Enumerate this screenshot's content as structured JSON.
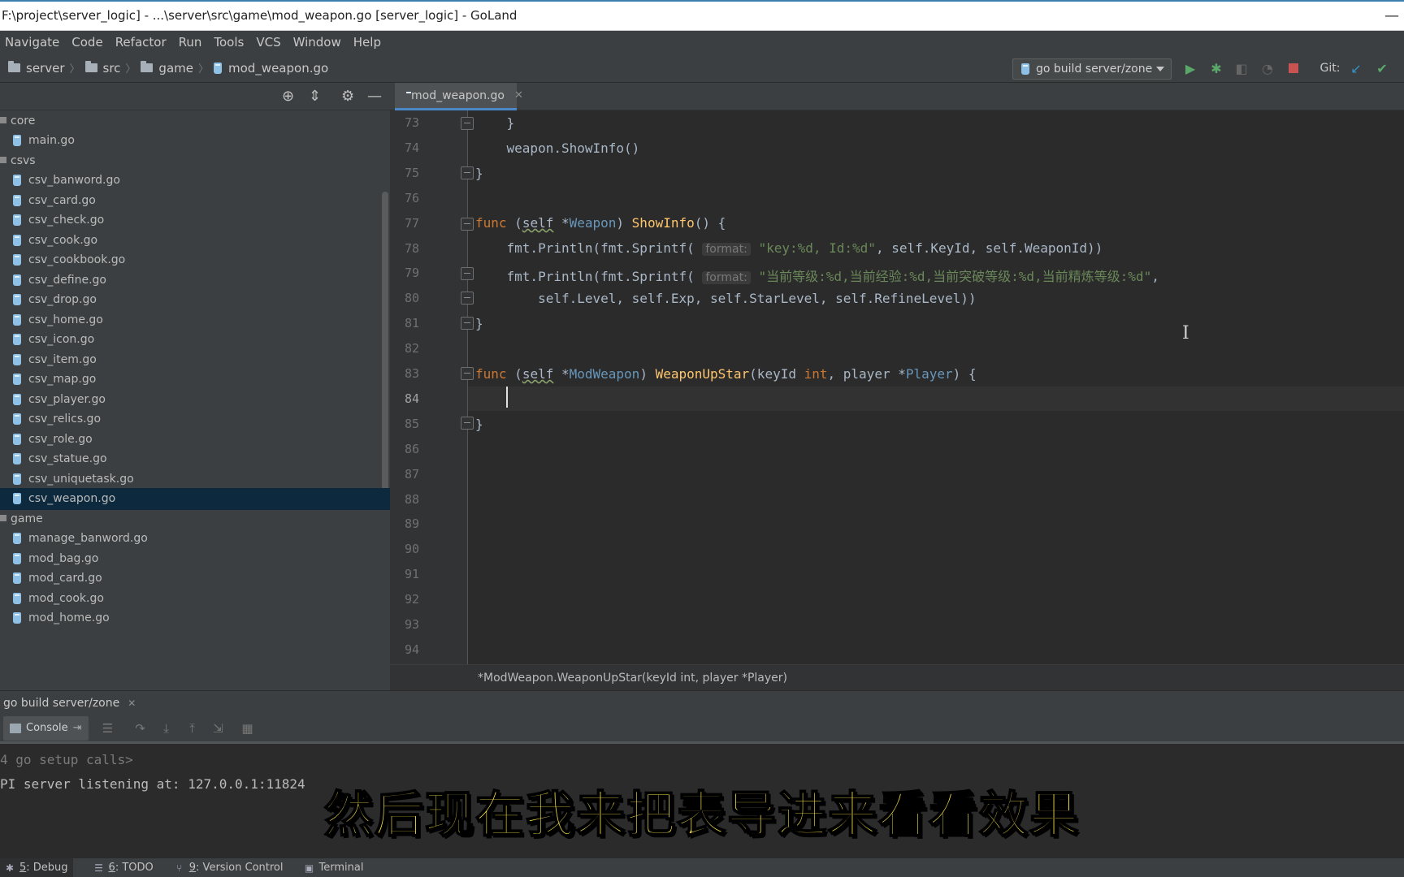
{
  "window": {
    "title": "F:\\project\\server_logic] - ...\\server\\src\\game\\mod_weapon.go [server_logic] - GoLand",
    "minimize_glyph": "—"
  },
  "menu": [
    "Navigate",
    "Code",
    "Refactor",
    "Run",
    "Tools",
    "VCS",
    "Window",
    "Help"
  ],
  "breadcrumbs": [
    "server",
    "src",
    "game",
    "mod_weapon.go"
  ],
  "run_config": {
    "label": "go build server/zone"
  },
  "vcs_label": "Git:",
  "project_tree": {
    "items": [
      {
        "kind": "dir",
        "label": "core"
      },
      {
        "kind": "file",
        "label": "main.go"
      },
      {
        "kind": "dir",
        "label": "csvs"
      },
      {
        "kind": "file",
        "label": "csv_banword.go"
      },
      {
        "kind": "file",
        "label": "csv_card.go"
      },
      {
        "kind": "file",
        "label": "csv_check.go"
      },
      {
        "kind": "file",
        "label": "csv_cook.go"
      },
      {
        "kind": "file",
        "label": "csv_cookbook.go"
      },
      {
        "kind": "file",
        "label": "csv_define.go"
      },
      {
        "kind": "file",
        "label": "csv_drop.go"
      },
      {
        "kind": "file",
        "label": "csv_home.go"
      },
      {
        "kind": "file",
        "label": "csv_icon.go"
      },
      {
        "kind": "file",
        "label": "csv_item.go"
      },
      {
        "kind": "file",
        "label": "csv_map.go"
      },
      {
        "kind": "file",
        "label": "csv_player.go"
      },
      {
        "kind": "file",
        "label": "csv_relics.go"
      },
      {
        "kind": "file",
        "label": "csv_role.go"
      },
      {
        "kind": "file",
        "label": "csv_statue.go"
      },
      {
        "kind": "file",
        "label": "csv_uniquetask.go"
      },
      {
        "kind": "file",
        "label": "csv_weapon.go",
        "selected": true
      },
      {
        "kind": "dir",
        "label": "game"
      },
      {
        "kind": "file",
        "label": "manage_banword.go"
      },
      {
        "kind": "file",
        "label": "mod_bag.go"
      },
      {
        "kind": "file",
        "label": "mod_card.go"
      },
      {
        "kind": "file",
        "label": "mod_cook.go"
      },
      {
        "kind": "file",
        "label": "mod_home.go"
      }
    ]
  },
  "editor": {
    "tab_label": "mod_weapon.go",
    "line_numbers": [
      "73",
      "74",
      "75",
      "76",
      "77",
      "78",
      "79",
      "80",
      "81",
      "82",
      "83",
      "84",
      "85",
      "86",
      "87",
      "88",
      "89",
      "90",
      "91",
      "92",
      "93",
      "94"
    ],
    "current_line": "84",
    "code": {
      "l73": "    }",
      "l74": "    weapon.ShowInfo()",
      "l75": "}",
      "l77": {
        "func": "func",
        "open": "(",
        "recv": "self",
        "star": " *",
        "type": "Weapon",
        "close": ") ",
        "name": "ShowInfo",
        "rest": "() {"
      },
      "l78": {
        "pre": "    fmt.Println(fmt.Sprintf(",
        "hint": "format:",
        "str": "\"key:%d, Id:%d\"",
        "rest": ", self.KeyId, self.WeaponId))"
      },
      "l79": {
        "pre": "    fmt.Println(fmt.Sprintf(",
        "hint": "format:",
        "str": "\"当前等级:%d,当前经验:%d,当前突破等级:%d,当前精炼等级:%d\"",
        "rest": ","
      },
      "l80": "        self.Level, self.Exp, self.StarLevel, self.RefineLevel))",
      "l81": "}",
      "l83": {
        "func": "func",
        "open": "(",
        "recv": "self",
        "star": " *",
        "type": "ModWeapon",
        "close": ") ",
        "name": "WeaponUpStar",
        "args_a": "(keyId ",
        "int": "int",
        "args_b": ", player *",
        "ptype": "Player",
        "rest": ") {"
      },
      "l85": "}"
    },
    "breadcrumb": "*ModWeapon.WeaponUpStar(keyId int, player *Player)"
  },
  "debug": {
    "title": "go build server/zone",
    "console_tab": "Console",
    "console_lines": [
      "4 go setup calls>",
      "PI server listening at: 127.0.0.1:11824"
    ]
  },
  "subtitle": "然后现在我来把表导进来看看效果",
  "status_tools": [
    {
      "num": "5",
      "label": ": Debug"
    },
    {
      "num": "6",
      "label": ": TODO"
    },
    {
      "num": "9",
      "label": ": Version Control"
    },
    {
      "num": "",
      "label": "Terminal"
    }
  ],
  "colors": {
    "keyword": "#cc7832",
    "function": "#ffc66d",
    "type": "#6897bb",
    "string": "#6a8759",
    "subtitle": "#f7e24a",
    "selection": "#0d293e"
  },
  "icons": [
    "run-icon",
    "debug-icon",
    "stop-icon",
    "locate-icon",
    "collapse-icon",
    "gear-icon",
    "hide-icon",
    "go-file-icon",
    "folder-icon",
    "vcs-update-icon",
    "vcs-commit-icon"
  ]
}
